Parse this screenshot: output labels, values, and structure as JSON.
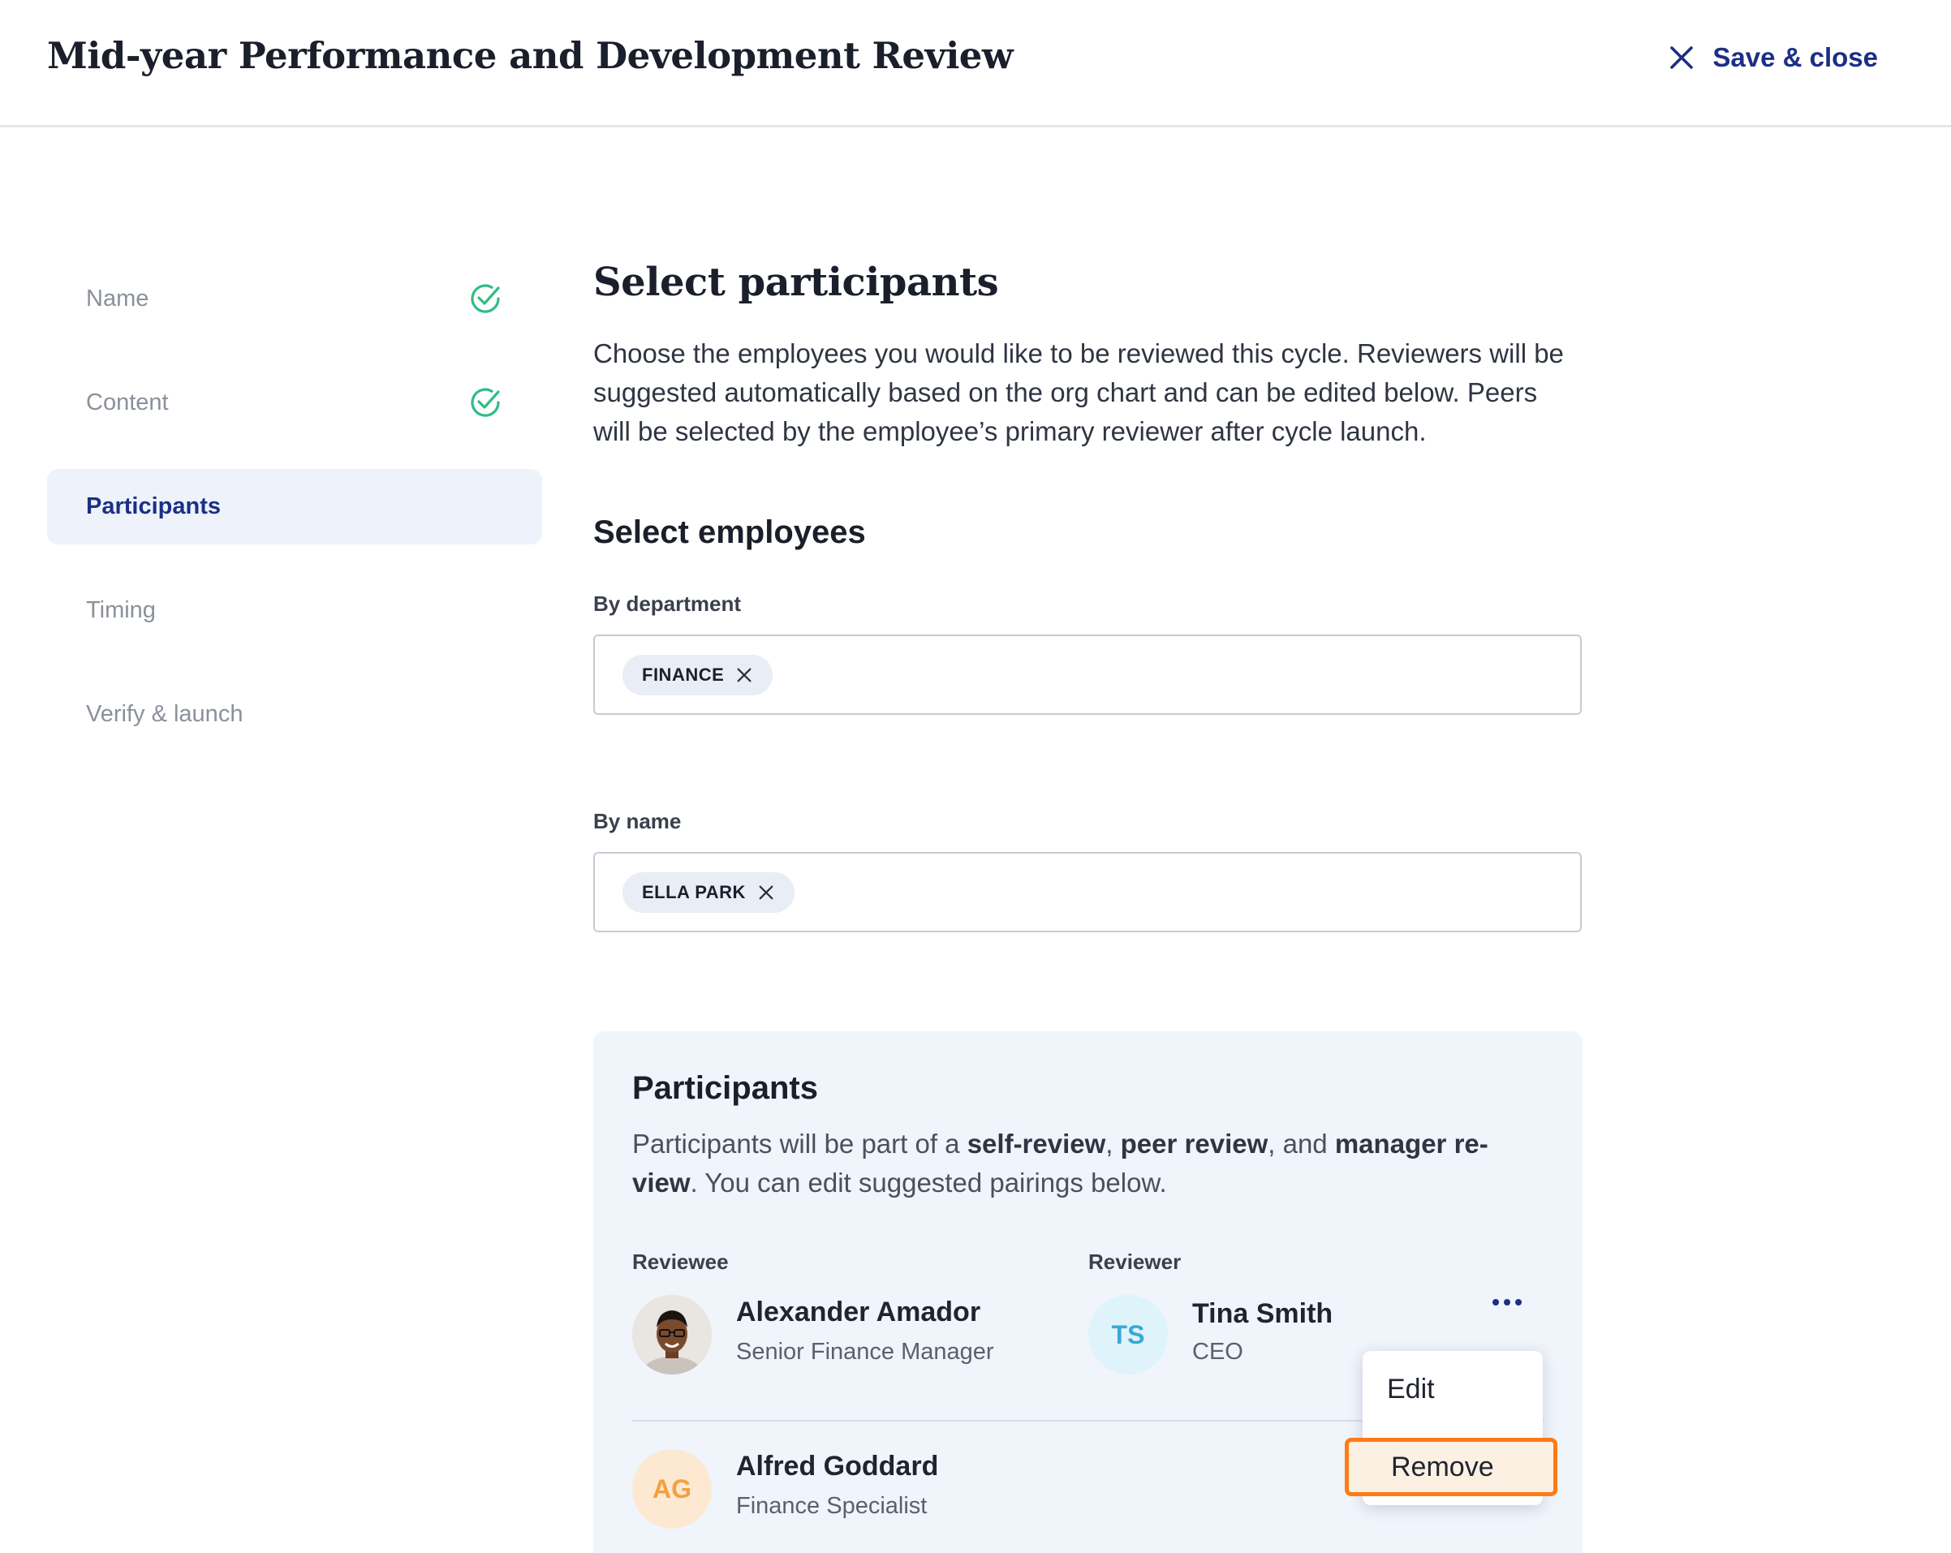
{
  "header": {
    "title": "Mid-year Performance and Development Review",
    "save_close_label": "Save & close",
    "close_icon": "close-icon"
  },
  "steps": [
    {
      "label": "Name",
      "status": "complete",
      "icon": "check-circle-icon"
    },
    {
      "label": "Content",
      "status": "complete",
      "icon": "check-circle-icon"
    },
    {
      "label": "Participants",
      "status": "active"
    },
    {
      "label": "Timing",
      "status": "upcoming"
    },
    {
      "label": "Verify & launch",
      "status": "upcoming"
    }
  ],
  "main": {
    "title": "Select participants",
    "intro_lines": [
      "Choose the employees you would like to be reviewed this cycle. Reviewers will be",
      "suggested automatically based on the org chart and can be edited below. Peers",
      "will be selected by the employee’s primary reviewer after cycle launch."
    ],
    "select_employees_heading": "Select employees",
    "by_department": {
      "label": "By department",
      "chips": [
        "FINANCE"
      ]
    },
    "by_name": {
      "label": "By name",
      "chips": [
        "ELLA PARK"
      ]
    }
  },
  "participants": {
    "title": "Participants",
    "desc_parts": {
      "p1": "Participants will be part of a ",
      "b1": "self-review",
      "p2": ", ",
      "b2": "peer review",
      "p3": ", and ",
      "b3": "manager re-",
      "b3b": "view",
      "p4": ". You can edit suggested pairings below."
    },
    "columns": {
      "reviewee": "Reviewee",
      "reviewer": "Reviewer"
    },
    "rows": [
      {
        "reviewee": {
          "name": "Alexander Amador",
          "role": "Senior Finance Manager",
          "avatar": "photo"
        },
        "reviewer": {
          "initials": "TS",
          "name": "Tina Smith",
          "role": "CEO"
        }
      },
      {
        "reviewee": {
          "initials": "AG",
          "name": "Alfred Goddard",
          "role": "Finance Specialist"
        }
      }
    ],
    "menu": {
      "items": [
        "Edit",
        "Remove"
      ],
      "highlighted": "Remove"
    }
  },
  "colors": {
    "accent": "#1b2f86",
    "success": "#2ebd85",
    "highlight": "#ff7a14",
    "ts_bg": "#dff3fb",
    "ts_text": "#38a9d6",
    "ag_bg": "#fde9d2",
    "ag_text": "#f4a040"
  }
}
